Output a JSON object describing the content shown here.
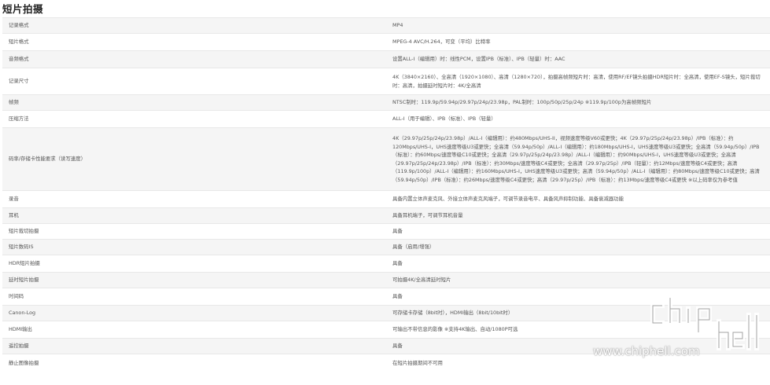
{
  "section_title": "短片拍摄",
  "rows": [
    {
      "label": "记录格式",
      "value": "MP4"
    },
    {
      "label": "短片格式",
      "value": "MPEG-4 AVC/H.264，可变（平均）比特率"
    },
    {
      "label": "音频格式",
      "value": "设置ALL-I（编辑用）时：线性PCM，设置IPB（标准）、IPB（轻量）时：AAC"
    },
    {
      "label": "记录尺寸",
      "value": "4K（3840×2160）、全高清（1920×1080）、高清（1280×720），拍摄高帧频短片时：高清，使用RF/EF镜头拍摄HDR短片时：全高清，使用EF-S镜头，短片裁切时：高清，拍摄延时短片时：4K/全高清"
    },
    {
      "label": "帧频",
      "value": "NTSC制时：119.9p/59.94p/29.97p/24p/23.98p，PAL制时：100p/50p/25p/24p ※119.9p/100p为高帧频短片"
    },
    {
      "label": "压缩方法",
      "value": "ALL-I（用于编辑）、IPB（标准）、IPB（轻量）"
    },
    {
      "label": "码率/存储卡性能要求（读写速度）",
      "value": "4K（29.97p/25p/24p/23.98p）/ALL-I（编辑用）：约480Mbps/UHS-II，视频速度等级V60或更快；4K（29.97p/25p/24p/23.98p）/IPB（标准）：约120Mbps/UHS-I，UHS速度等级U3或更快；全高清（59.94p/50p）/ALL-I（编辑用）：约180Mbps/UHS-I，UHS速度等级U3或更快；全高清（59.94p/50p）/IPB（标准）：约60Mbps/速度等级C10或更快；全高清（29.97p/25p/24p/23.98p）/ALL-I（编辑用）：约90Mbps/UHS-I，UHS速度等级U3或更快；全高清（29.97p/25p/24p/23.98p）/IPB（标准）：约30Mbps/速度等级C4或更快；全高清（29.97p/25p）/IPB（轻量）：约12Mbps/速度等级C4或更快；高清（119.9p/100p）/ALL-I（编辑用）：约160Mbps/UHS-I，UHS速度等级U3或更快；高清（59.94p/50p）/ALL-I（编辑用）：约80Mbps/速度等级C10或更快；高清（59.94p/50p）/IPB（标准）：约26Mbps/速度等级C4或更快；高清（29.97p/25p）/IPB（标准）：约13Mbps/速度等级C4或更快 ※以上码率仅为参考值"
    },
    {
      "label": "录音",
      "value": "具备内置立体声麦克风、外接立体声麦克风端子，可调节录音电平、具备风声抑制功能、具备衰减器功能"
    },
    {
      "label": "耳机",
      "value": "具备耳机端子，可调节耳机音量"
    },
    {
      "label": "短片裁切拍摄",
      "value": "具备"
    },
    {
      "label": "短片数码IS",
      "value": "具备（启用/增强）"
    },
    {
      "label": "HDR短片拍摄",
      "value": "具备"
    },
    {
      "label": "延时短片拍摄",
      "value": "可拍摄4K/全高清延时短片"
    },
    {
      "label": "时间码",
      "value": "具备"
    },
    {
      "label": "Canon-Log",
      "value": "可存储卡存储（8bit时），HDMI输出（8bit/10bit时）"
    },
    {
      "label": "HDMI输出",
      "value": "可输出不带信息的影像 ※支持4K输出、自动/1080P可选"
    },
    {
      "label": "遥控拍摄",
      "value": "具备"
    },
    {
      "label": "静止图像拍摄",
      "value": "在短片拍摄期间不可用"
    }
  ],
  "watermark": {
    "logo_text": "chiphell",
    "url": "www.chiphell.com"
  }
}
